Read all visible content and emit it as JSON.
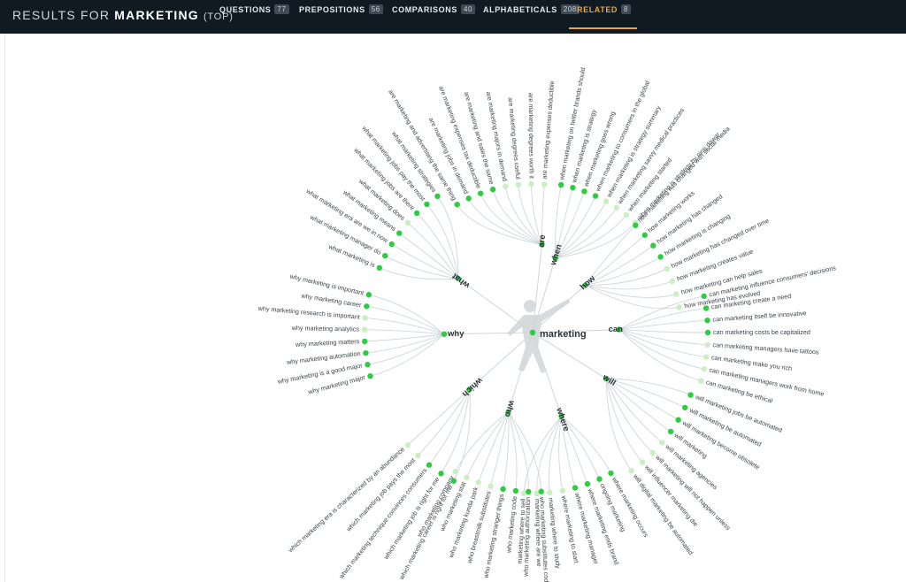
{
  "header": {
    "prefix": "RESULTS FOR",
    "keyword": "MARKETING",
    "mode": "(TOP)"
  },
  "tabs": [
    {
      "label": "QUESTIONS",
      "count": "77",
      "active": false
    },
    {
      "label": "PREPOSITIONS",
      "count": "56",
      "active": false
    },
    {
      "label": "COMPARISONS",
      "count": "40",
      "active": false
    },
    {
      "label": "ALPHABETICALS",
      "count": "208",
      "active": false
    },
    {
      "label": "RELATED",
      "count": "8",
      "active": true
    }
  ],
  "colors": {
    "topbar": "#0f1a22",
    "active_tab": "#e8a64a",
    "dot_strong": "#2ecc40",
    "dot_light": "#c8f0c0",
    "link": "#ced6da"
  },
  "wheel": {
    "center_label": "marketing",
    "center_icon": "person-silhouette-icon",
    "branches": [
      {
        "word": "are",
        "items": [
          "are marketing and advertising the same thing",
          "are marketing jobs in demand",
          "are marketing expenses tax deductible",
          "are marketing and sales the same",
          "are marketing majors in demand",
          "are marketing degrees useful",
          "are marketing degrees worth it",
          "are marketing expenses deductible"
        ]
      },
      {
        "word": "when",
        "items": [
          "when marketing on twitter brands should",
          "when marketing is strategy",
          "when marketing goes wrong",
          "when marketing to consumers in the global",
          "when marketing is strategy summary",
          "when marketing savvy medical practices",
          "when marketing started",
          "when marketing is strategy by niraj dawar"
        ]
      },
      {
        "word": "how",
        "items": [
          "how marketing has changed with social media",
          "how marketing works",
          "how marketing has changed",
          "how marketing is changing",
          "how marketing has changed over time",
          "how marketing creates value",
          "how marketing can help sales",
          "how marketing has evolved"
        ]
      },
      {
        "word": "can",
        "items": [
          "can marketing influence consumers' decisions",
          "can marketing create a need",
          "can marketing itself be innovative",
          "can marketing costs be capitalized",
          "can marketing managers have tattoos",
          "can marketing make you rich",
          "can marketing managers work from home",
          "can marketing be ethical"
        ]
      },
      {
        "word": "will",
        "items": [
          "will marketing jobs be automated",
          "will marketing be automated",
          "will marketing become obsolete",
          "will marketing",
          "will marketing agencies",
          "will marketing will not happen unless",
          "will influencer marketing die",
          "will digital marketing be automated"
        ]
      },
      {
        "word": "where",
        "items": [
          "where marketing occurs",
          "ongoing marketing",
          "where marketing ends brand",
          "where marketing manager",
          "where marketing to start",
          "marketing where to study",
          "marketing where are we",
          "marketing where to sell"
        ]
      },
      {
        "word": "who",
        "items": [
          "who marketing substitutes code",
          "who marketing authorization",
          "who marketing code",
          "who marketing stranger things",
          "who breastmilk substitutes",
          "who marketing kunda park",
          "who marketing stat",
          "who marketing company"
        ]
      },
      {
        "word": "which",
        "items": [
          "which marketing career is right for me",
          "which marketing job is right for me",
          "which marketing technique convinces consumers",
          "which marketing job pays the most",
          "which marketing era is characterized by an abundance"
        ]
      },
      {
        "word": "why",
        "items": [
          "why marketing major",
          "why marketing is a good major",
          "why marketing automation",
          "why marketing matters",
          "why marketing analytics",
          "why marketing research is important",
          "why marketing career",
          "why marketing is important"
        ]
      },
      {
        "word": "what",
        "items": [
          "what marketing is",
          "what marketing manager do",
          "what marketing era are we in now",
          "what marketing means",
          "what marketing does",
          "what marketing jobs are there",
          "what marketing jobs pay the most",
          "what marketing strategies"
        ]
      }
    ]
  }
}
